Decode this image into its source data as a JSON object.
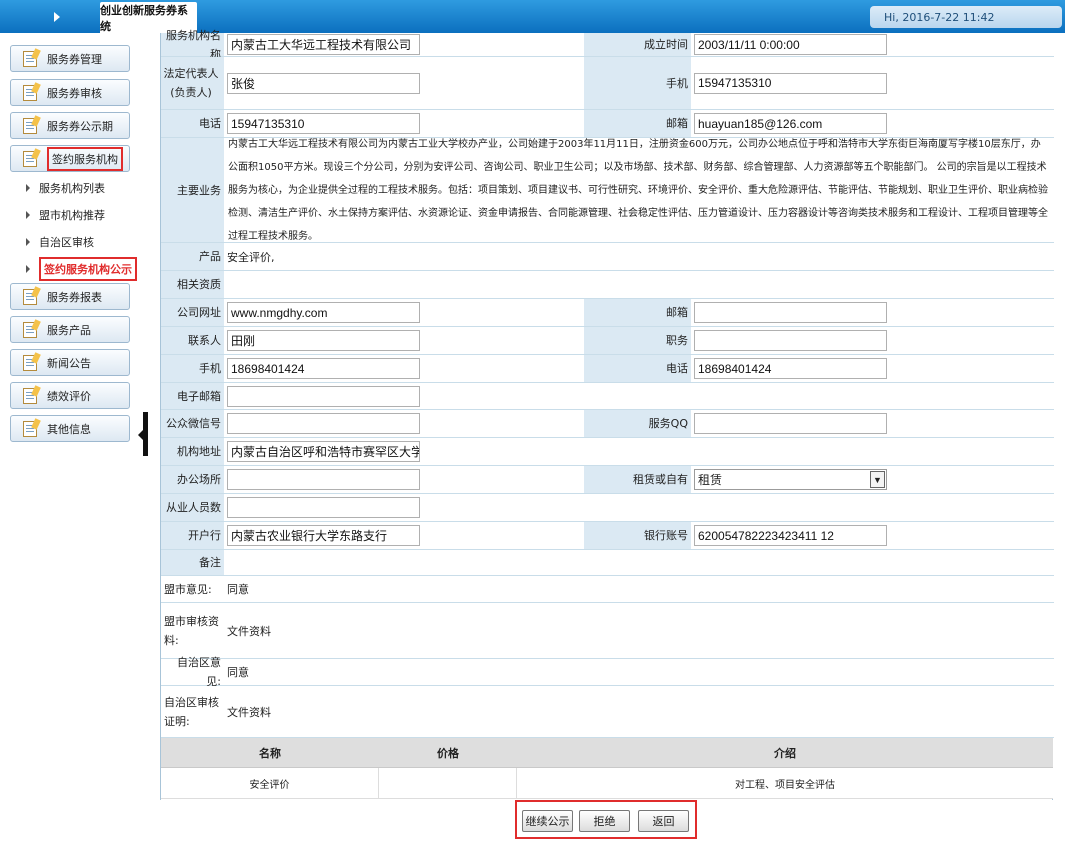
{
  "header": {
    "system_title": "创业创新服务券系统",
    "greeting": "Hi, 2016-7-22 11:42"
  },
  "sidebar": {
    "items": [
      {
        "label": "服务券管理"
      },
      {
        "label": "服务券审核"
      },
      {
        "label": "服务券公示期"
      },
      {
        "label": "签约服务机构"
      },
      {
        "label": "服务券报表"
      },
      {
        "label": "服务产品"
      },
      {
        "label": "新闻公告"
      },
      {
        "label": "绩效评价"
      },
      {
        "label": "其他信息"
      }
    ],
    "sub_items": [
      {
        "label": "服务机构列表"
      },
      {
        "label": "盟市机构推荐"
      },
      {
        "label": "自治区审核"
      },
      {
        "label": "签约服务机构公示"
      }
    ]
  },
  "form": {
    "org_name_label": "服务机构名称",
    "org_name": "内蒙古工大华远工程技术有限公司",
    "founded_label": "成立时间",
    "founded": "2003/11/11 0:00:00",
    "legal_rep_label": "法定代表人(负责人)",
    "legal_rep": "张俊",
    "mobile_label": "手机",
    "mobile": "15947135310",
    "phone_label": "电话",
    "phone": "15947135310",
    "email_label": "邮箱",
    "email": "huayuan185@126.com",
    "business_label": "主要业务",
    "business": "内蒙古工大华远工程技术有限公司为内蒙古工业大学校办产业，公司始建于2003年11月11日，注册资金600万元，公司办公地点位于呼和浩特市大学东街巨海南厦写字楼10层东厅，办公面积1050平方米。现设三个分公司，分别为安评公司、咨询公司、职业卫生公司；以及市场部、技术部、财务部、综合管理部、人力资源部等五个职能部门。 公司的宗旨是以工程技术服务为核心，为企业提供全过程的工程技术服务。包括：项目策划、项目建议书、可行性研究、环境评价、安全评价、重大危险源评估、节能评估、节能规划、职业卫生评价、职业病检验检测、清洁生产评价、水土保持方案评估、水资源论证、资金申请报告、合同能源管理、社会稳定性评估、压力管道设计、压力容器设计等咨询类技术服务和工程设计、工程项目管理等全过程工程技术服务。",
    "product_label": "产品",
    "product": "安全评价,",
    "qualification_label": "相关资质",
    "qualification": "",
    "website_label": "公司网址",
    "website": "www.nmgdhy.com",
    "email2_label": "邮箱",
    "email2": "",
    "contact_label": "联系人",
    "contact": "田刚",
    "position_label": "职务",
    "position": "",
    "mobile2_label": "手机",
    "mobile2": "18698401424",
    "phone2_label": "电话",
    "phone2": "18698401424",
    "email3_label": "电子邮箱",
    "email3": "",
    "wechat_label": "公众微信号",
    "wechat": "",
    "qq_label": "服务QQ",
    "qq": "",
    "address_label": "机构地址",
    "address": "内蒙古自治区呼和浩特市赛罕区大学东街巨",
    "office_label": "办公场所",
    "office": "",
    "lease_label": "租赁或自有",
    "lease": "租赁",
    "staff_label": "从业人员数",
    "staff": "",
    "bank_label": "开户行",
    "bank": "内蒙古农业银行大学东路支行",
    "account_label": "银行账号",
    "account": "620054782223423411 12",
    "remark_label": "备注",
    "remark": "",
    "league_opinion_label": "盟市意见:",
    "league_opinion": "同意",
    "league_material_label": "盟市审核资料:",
    "league_material": "文件资料",
    "region_opinion_label": "自治区意见:",
    "region_opinion": "同意",
    "region_cert_label": "自治区审核证明:",
    "region_cert": "文件资料"
  },
  "products_table": {
    "headers": [
      "名称",
      "价格",
      "介绍"
    ],
    "rows": [
      {
        "name": "安全评价",
        "price": "",
        "intro": "对工程、项目安全评估"
      }
    ]
  },
  "buttons": {
    "continue": "继续公示",
    "reject": "拒绝",
    "back": "返回"
  }
}
